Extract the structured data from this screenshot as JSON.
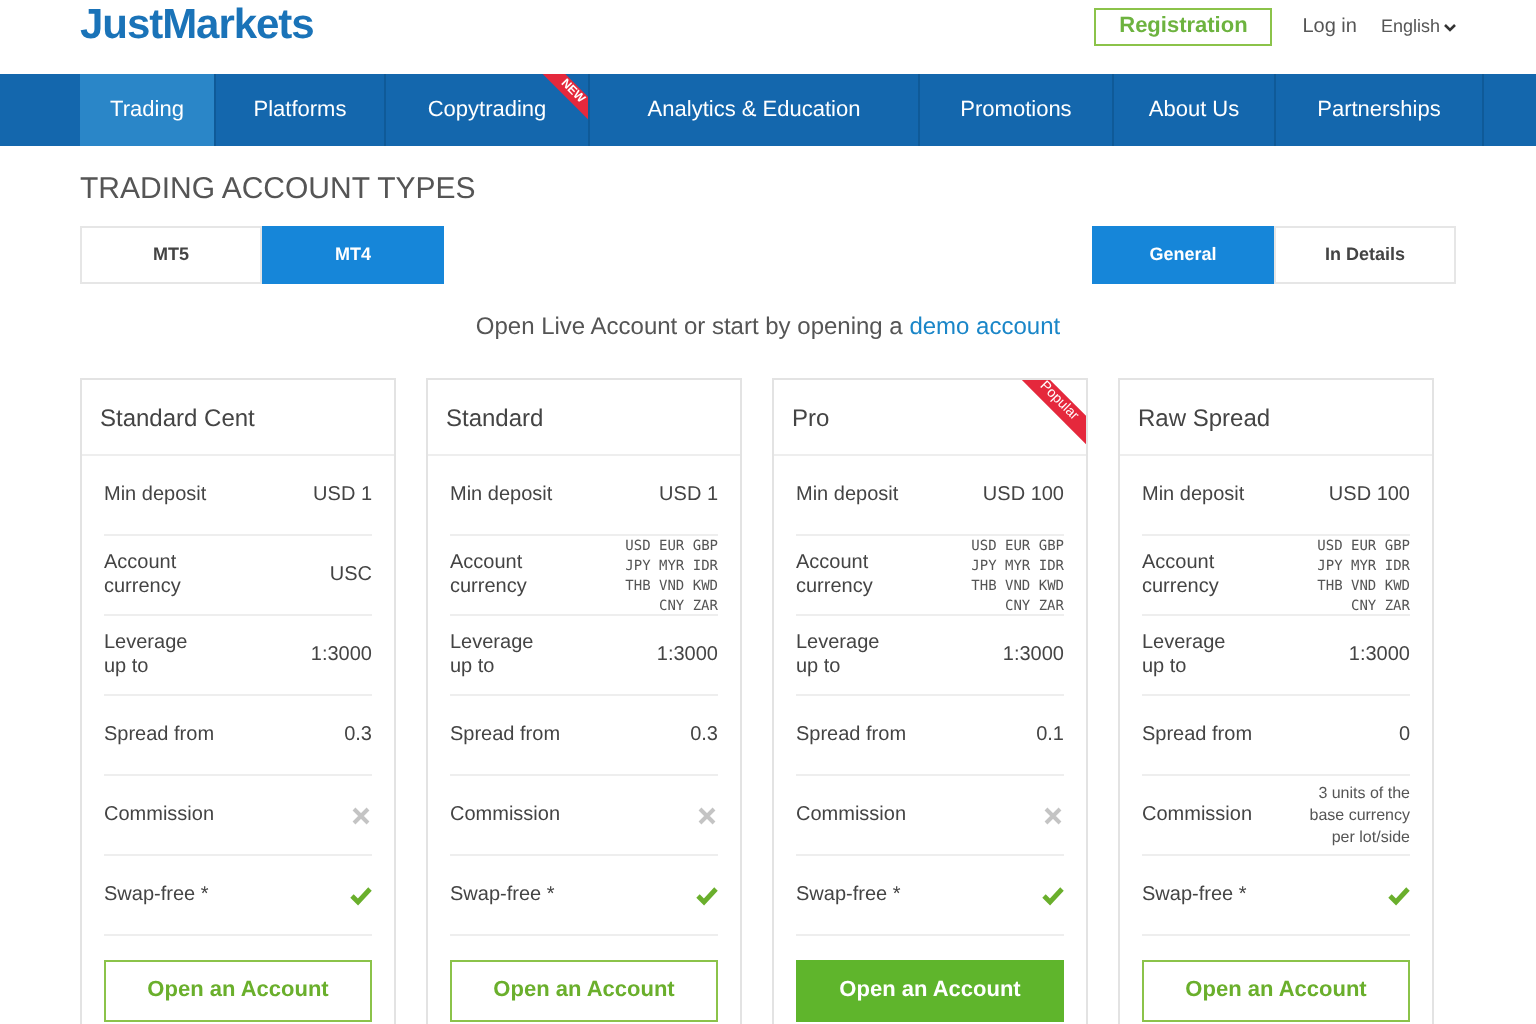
{
  "header": {
    "logo": "JustMarkets",
    "registration": "Registration",
    "login": "Log in",
    "language": "English"
  },
  "nav": [
    {
      "label": "Trading",
      "selected": true
    },
    {
      "label": "Platforms",
      "selected": false
    },
    {
      "label": "Copytrading",
      "selected": false,
      "badge": "NEW"
    },
    {
      "label": "Analytics & Education",
      "selected": false
    },
    {
      "label": "Promotions",
      "selected": false
    },
    {
      "label": "About Us",
      "selected": false
    },
    {
      "label": "Partnerships",
      "selected": false
    }
  ],
  "title": "TRADING ACCOUNT TYPES",
  "platform_tabs": [
    {
      "label": "MT5",
      "selected": false
    },
    {
      "label": "MT4",
      "selected": true
    }
  ],
  "view_tabs": [
    {
      "label": "General",
      "selected": true
    },
    {
      "label": "In Details",
      "selected": false
    }
  ],
  "intro": {
    "text": "Open Live Account or start by opening a",
    "link": "demo account"
  },
  "accounts": [
    {
      "name": "Standard Cent",
      "rows": [
        {
          "kind": "text",
          "label": "Min deposit",
          "value": "USD 1"
        },
        {
          "kind": "text",
          "label": "Account currency",
          "value": "USC"
        },
        {
          "kind": "text",
          "label": "Leverage up to",
          "value": "1:3000"
        },
        {
          "kind": "text",
          "label": "Spread from",
          "value": "0.3"
        },
        {
          "kind": "flag",
          "label": "Commission",
          "available": false
        },
        {
          "kind": "flag",
          "label": "Swap-free *",
          "available": true
        }
      ],
      "button": "Open an Account",
      "primary": false
    },
    {
      "name": "Standard",
      "rows": [
        {
          "kind": "text",
          "label": "Min deposit",
          "value": "USD 1"
        },
        {
          "kind": "codes",
          "label": "Account currency",
          "value": "USD EUR GBP JPY MYR IDR THB VND KWD CNY ZAR"
        },
        {
          "kind": "text",
          "label": "Leverage up to",
          "value": "1:3000"
        },
        {
          "kind": "text",
          "label": "Spread from",
          "value": "0.3"
        },
        {
          "kind": "flag",
          "label": "Commission",
          "available": false
        },
        {
          "kind": "flag",
          "label": "Swap-free *",
          "available": true
        }
      ],
      "button": "Open an Account",
      "primary": false
    },
    {
      "name": "Pro",
      "ribbon": "Popular",
      "rows": [
        {
          "kind": "text",
          "label": "Min deposit",
          "value": "USD 100"
        },
        {
          "kind": "codes",
          "label": "Account currency",
          "value": "USD EUR GBP JPY MYR IDR THB VND KWD CNY ZAR"
        },
        {
          "kind": "text",
          "label": "Leverage up to",
          "value": "1:3000"
        },
        {
          "kind": "text",
          "label": "Spread from",
          "value": "0.1"
        },
        {
          "kind": "flag",
          "label": "Commission",
          "available": false
        },
        {
          "kind": "flag",
          "label": "Swap-free *",
          "available": true
        }
      ],
      "button": "Open an Account",
      "primary": true
    },
    {
      "name": "Raw Spread",
      "rows": [
        {
          "kind": "text",
          "label": "Min deposit",
          "value": "USD 100"
        },
        {
          "kind": "codes",
          "label": "Account currency",
          "value": "USD EUR GBP JPY MYR IDR THB VND KWD CNY ZAR"
        },
        {
          "kind": "text",
          "label": "Leverage up to",
          "value": "1:3000"
        },
        {
          "kind": "text",
          "label": "Spread from",
          "value": "0"
        },
        {
          "kind": "note",
          "label": "Commission",
          "value": "3 units of the base currency per lot/side"
        },
        {
          "kind": "flag",
          "label": "Swap-free *",
          "available": true
        }
      ],
      "button": "Open an Account",
      "primary": false
    }
  ]
}
